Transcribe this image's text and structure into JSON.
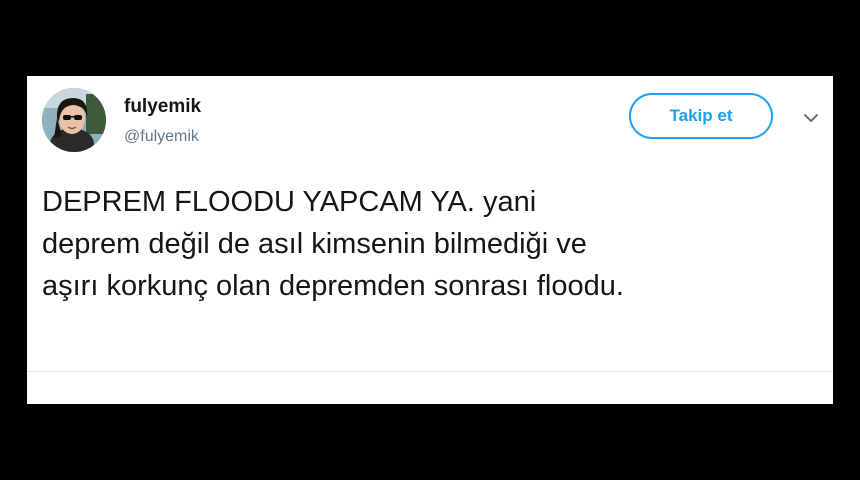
{
  "tweet": {
    "display_name": "fulyemik",
    "handle": "@fulyemik",
    "follow_label": "Takip et",
    "text_lines": [
      "DEPREM FLOODU YAPCAM YA. yani",
      "deprem değil de asıl kimsenin bilmediği ve",
      "aşırı korkunç olan depremden sonrası floodu."
    ]
  },
  "icons": {
    "avatar": "profile-photo",
    "menu": "chevron-down-icon"
  },
  "colors": {
    "background": "#000000",
    "card": "#ffffff",
    "accent": "#1da1f2",
    "text": "#14171a",
    "secondary_text": "#657786"
  }
}
